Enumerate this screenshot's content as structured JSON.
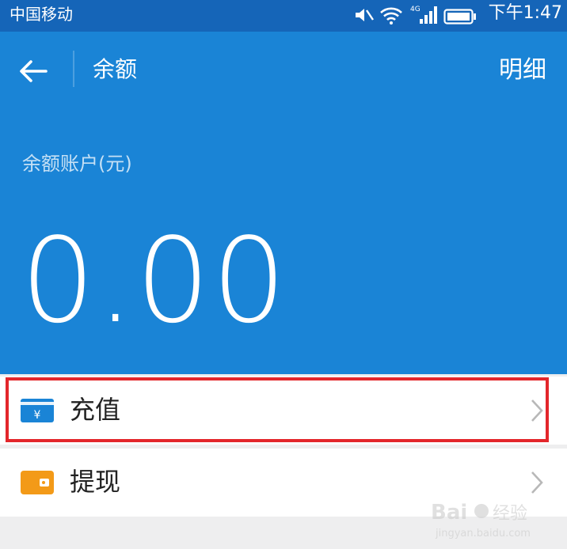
{
  "status_bar": {
    "carrier": "中国移动",
    "network_badge": "4G",
    "time": "下午1:47",
    "icons": [
      "mute-icon",
      "wifi-icon",
      "signal-icon",
      "battery-icon"
    ]
  },
  "header": {
    "title": "余额",
    "detail_link": "明细",
    "balance_label": "余额账户(元)",
    "balance_amount": "0.00",
    "background_color": "#1a84d6"
  },
  "menu": {
    "items": [
      {
        "label": "充值",
        "icon": "recharge-card-icon",
        "icon_symbol": "¥",
        "icon_color": "#1a84d6",
        "highlighted": true
      },
      {
        "label": "提现",
        "icon": "wallet-icon",
        "icon_color": "#f39a18",
        "highlighted": false
      }
    ]
  },
  "annotation": {
    "highlight_color": "#e3262b"
  },
  "watermark": {
    "brand": "Bai",
    "brand_cn": "经验",
    "url": "jingyan.baidu.com"
  }
}
